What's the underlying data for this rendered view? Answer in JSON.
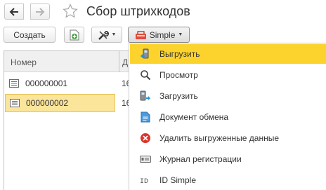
{
  "window": {
    "title": "Сбор штрихкодов"
  },
  "toolbar": {
    "create_label": "Создать",
    "simple_label": "Simple"
  },
  "table": {
    "headers": [
      "Номер",
      "Д"
    ],
    "rows": [
      {
        "number": "000000001",
        "date": "16"
      },
      {
        "number": "000000002",
        "date": "16"
      }
    ]
  },
  "menu": {
    "items": [
      {
        "label": "Выгрузить",
        "icon": "scanner-upload-icon"
      },
      {
        "label": "Просмотр",
        "icon": "magnifier-icon"
      },
      {
        "label": "Загрузить",
        "icon": "scanner-download-icon"
      },
      {
        "label": "Документ обмена",
        "icon": "document-icon"
      },
      {
        "label": "Удалить выгруженные данные",
        "icon": "delete-icon"
      },
      {
        "label": "Журнал регистрации",
        "icon": "log-icon"
      },
      {
        "label": "ID Simple",
        "icon": "id-icon"
      }
    ]
  },
  "colors": {
    "highlight": "#fcd32c",
    "selected_row": "#fbe59b",
    "delete_red": "#d9342b"
  }
}
